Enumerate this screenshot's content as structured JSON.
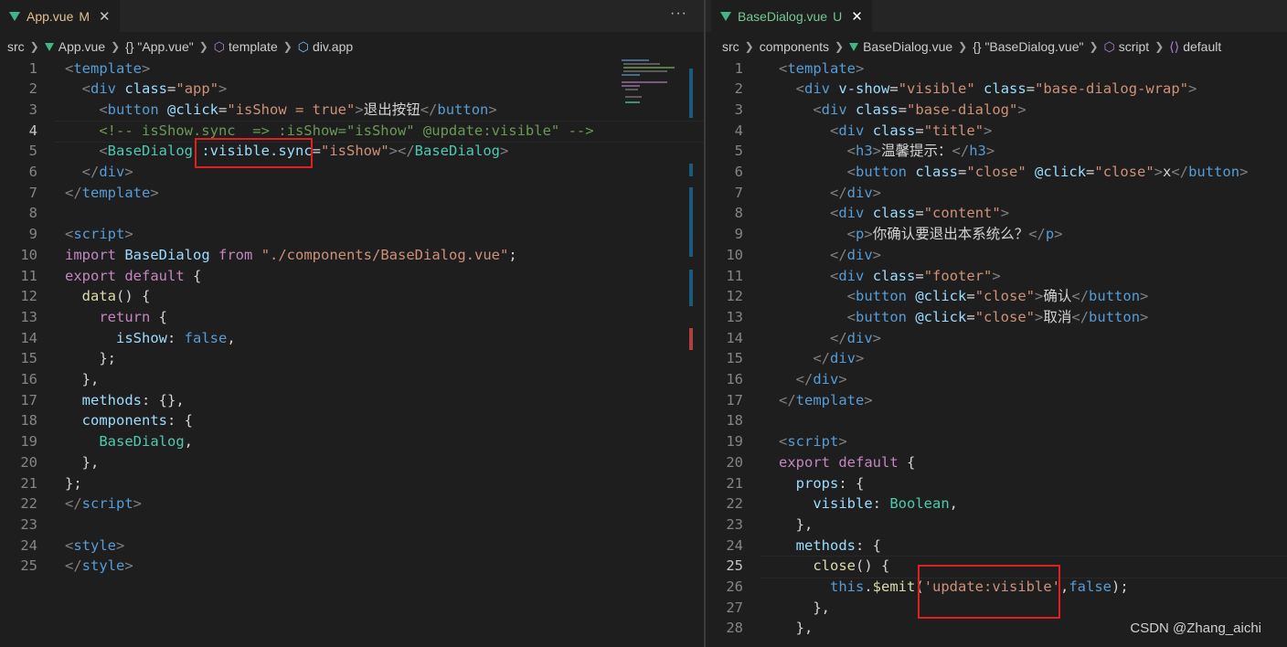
{
  "left": {
    "tab": {
      "name": "App.vue",
      "flag": "M",
      "close": "✕"
    },
    "more": "···",
    "breadcrumb": [
      "src",
      "App.vue",
      "{} \"App.vue\"",
      "template",
      "div.app"
    ],
    "lines": [
      [
        [
          "t-tag",
          "<"
        ],
        [
          "t-el",
          "template"
        ],
        [
          "t-tag",
          ">"
        ]
      ],
      [
        [
          "t-txt",
          "  "
        ],
        [
          "t-tag",
          "<"
        ],
        [
          "t-el",
          "div"
        ],
        [
          "t-txt",
          " "
        ],
        [
          "t-attr",
          "class"
        ],
        [
          "t-txt",
          "="
        ],
        [
          "t-str",
          "\"app\""
        ],
        [
          "t-tag",
          ">"
        ]
      ],
      [
        [
          "t-txt",
          "    "
        ],
        [
          "t-tag",
          "<"
        ],
        [
          "t-el",
          "button"
        ],
        [
          "t-txt",
          " "
        ],
        [
          "t-attr",
          "@click"
        ],
        [
          "t-txt",
          "="
        ],
        [
          "t-str",
          "\"isShow = true\""
        ],
        [
          "t-tag",
          ">"
        ],
        [
          "t-txt",
          "退出按钮"
        ],
        [
          "t-tag",
          "</"
        ],
        [
          "t-el",
          "button"
        ],
        [
          "t-tag",
          ">"
        ]
      ],
      [
        [
          "t-txt",
          "    "
        ],
        [
          "t-com",
          "<!-- isShow.sync  => :isShow=\"isShow\" @update:visible\" -->"
        ]
      ],
      [
        [
          "t-txt",
          "    "
        ],
        [
          "t-tag",
          "<"
        ],
        [
          "t-comp",
          "BaseDialog"
        ],
        [
          "t-txt",
          " "
        ],
        [
          "t-attr",
          ":visible.sync"
        ],
        [
          "t-txt",
          "="
        ],
        [
          "t-str",
          "\"isShow\""
        ],
        [
          "t-tag",
          "></"
        ],
        [
          "t-comp",
          "BaseDialog"
        ],
        [
          "t-tag",
          ">"
        ]
      ],
      [
        [
          "t-txt",
          "  "
        ],
        [
          "t-tag",
          "</"
        ],
        [
          "t-el",
          "div"
        ],
        [
          "t-tag",
          ">"
        ]
      ],
      [
        [
          "t-tag",
          "</"
        ],
        [
          "t-el",
          "template"
        ],
        [
          "t-tag",
          ">"
        ]
      ],
      [],
      [
        [
          "t-tag",
          "<"
        ],
        [
          "t-el",
          "script"
        ],
        [
          "t-tag",
          ">"
        ]
      ],
      [
        [
          "t-kw",
          "import"
        ],
        [
          "t-txt",
          " "
        ],
        [
          "t-pr",
          "BaseDialog"
        ],
        [
          "t-txt",
          " "
        ],
        [
          "t-kw",
          "from"
        ],
        [
          "t-txt",
          " "
        ],
        [
          "t-str",
          "\"./components/BaseDialog.vue\""
        ],
        [
          "t-txt",
          ";"
        ]
      ],
      [
        [
          "t-kw",
          "export"
        ],
        [
          "t-txt",
          " "
        ],
        [
          "t-kw",
          "default"
        ],
        [
          "t-txt",
          " {"
        ]
      ],
      [
        [
          "t-txt",
          "  "
        ],
        [
          "t-fn",
          "data"
        ],
        [
          "t-txt",
          "() {"
        ]
      ],
      [
        [
          "t-txt",
          "    "
        ],
        [
          "t-kw",
          "return"
        ],
        [
          "t-txt",
          " {"
        ]
      ],
      [
        [
          "t-txt",
          "      "
        ],
        [
          "t-pr",
          "isShow"
        ],
        [
          "t-txt",
          ": "
        ],
        [
          "t-kwb",
          "false"
        ],
        [
          "t-txt",
          ","
        ]
      ],
      [
        [
          "t-txt",
          "    };"
        ]
      ],
      [
        [
          "t-txt",
          "  },"
        ]
      ],
      [
        [
          "t-txt",
          "  "
        ],
        [
          "t-pr",
          "methods"
        ],
        [
          "t-txt",
          ": {},"
        ]
      ],
      [
        [
          "t-txt",
          "  "
        ],
        [
          "t-pr",
          "components"
        ],
        [
          "t-txt",
          ": {"
        ]
      ],
      [
        [
          "t-txt",
          "    "
        ],
        [
          "t-comp",
          "BaseDialog"
        ],
        [
          "t-txt",
          ","
        ]
      ],
      [
        [
          "t-txt",
          "  },"
        ]
      ],
      [
        [
          "t-txt",
          "};"
        ]
      ],
      [
        [
          "t-tag",
          "</"
        ],
        [
          "t-el",
          "script"
        ],
        [
          "t-tag",
          ">"
        ]
      ],
      [],
      [
        [
          "t-tag",
          "<"
        ],
        [
          "t-el",
          "style"
        ],
        [
          "t-tag",
          ">"
        ]
      ],
      [
        [
          "t-tag",
          "</"
        ],
        [
          "t-el",
          "style"
        ],
        [
          "t-tag",
          ">"
        ]
      ]
    ]
  },
  "right": {
    "tab": {
      "name": "BaseDialog.vue",
      "flag": "U",
      "close": "✕"
    },
    "breadcrumb": [
      "src",
      "components",
      "BaseDialog.vue",
      "{} \"BaseDialog.vue\"",
      "script",
      "default"
    ],
    "lines": [
      [
        [
          "t-tag",
          "<"
        ],
        [
          "t-el",
          "template"
        ],
        [
          "t-tag",
          ">"
        ]
      ],
      [
        [
          "t-txt",
          "  "
        ],
        [
          "t-tag",
          "<"
        ],
        [
          "t-el",
          "div"
        ],
        [
          "t-txt",
          " "
        ],
        [
          "t-attr",
          "v-show"
        ],
        [
          "t-txt",
          "="
        ],
        [
          "t-str",
          "\"visible\""
        ],
        [
          "t-txt",
          " "
        ],
        [
          "t-attr",
          "class"
        ],
        [
          "t-txt",
          "="
        ],
        [
          "t-str",
          "\"base-dialog-wrap\""
        ],
        [
          "t-tag",
          ">"
        ]
      ],
      [
        [
          "t-txt",
          "    "
        ],
        [
          "t-tag",
          "<"
        ],
        [
          "t-el",
          "div"
        ],
        [
          "t-txt",
          " "
        ],
        [
          "t-attr",
          "class"
        ],
        [
          "t-txt",
          "="
        ],
        [
          "t-str",
          "\"base-dialog\""
        ],
        [
          "t-tag",
          ">"
        ]
      ],
      [
        [
          "t-txt",
          "      "
        ],
        [
          "t-tag",
          "<"
        ],
        [
          "t-el",
          "div"
        ],
        [
          "t-txt",
          " "
        ],
        [
          "t-attr",
          "class"
        ],
        [
          "t-txt",
          "="
        ],
        [
          "t-str",
          "\"title\""
        ],
        [
          "t-tag",
          ">"
        ]
      ],
      [
        [
          "t-txt",
          "        "
        ],
        [
          "t-tag",
          "<"
        ],
        [
          "t-el",
          "h3"
        ],
        [
          "t-tag",
          ">"
        ],
        [
          "t-txt",
          "温馨提示："
        ],
        [
          "t-tag",
          "</"
        ],
        [
          "t-el",
          "h3"
        ],
        [
          "t-tag",
          ">"
        ]
      ],
      [
        [
          "t-txt",
          "        "
        ],
        [
          "t-tag",
          "<"
        ],
        [
          "t-el",
          "button"
        ],
        [
          "t-txt",
          " "
        ],
        [
          "t-attr",
          "class"
        ],
        [
          "t-txt",
          "="
        ],
        [
          "t-str",
          "\"close\""
        ],
        [
          "t-txt",
          " "
        ],
        [
          "t-attr",
          "@click"
        ],
        [
          "t-txt",
          "="
        ],
        [
          "t-str",
          "\"close\""
        ],
        [
          "t-tag",
          ">"
        ],
        [
          "t-txt",
          "x"
        ],
        [
          "t-tag",
          "</"
        ],
        [
          "t-el",
          "button"
        ],
        [
          "t-tag",
          ">"
        ]
      ],
      [
        [
          "t-txt",
          "      "
        ],
        [
          "t-tag",
          "</"
        ],
        [
          "t-el",
          "div"
        ],
        [
          "t-tag",
          ">"
        ]
      ],
      [
        [
          "t-txt",
          "      "
        ],
        [
          "t-tag",
          "<"
        ],
        [
          "t-el",
          "div"
        ],
        [
          "t-txt",
          " "
        ],
        [
          "t-attr",
          "class"
        ],
        [
          "t-txt",
          "="
        ],
        [
          "t-str",
          "\"content\""
        ],
        [
          "t-tag",
          ">"
        ]
      ],
      [
        [
          "t-txt",
          "        "
        ],
        [
          "t-tag",
          "<"
        ],
        [
          "t-el",
          "p"
        ],
        [
          "t-tag",
          ">"
        ],
        [
          "t-txt",
          "你确认要退出本系统么？"
        ],
        [
          "t-tag",
          "</"
        ],
        [
          "t-el",
          "p"
        ],
        [
          "t-tag",
          ">"
        ]
      ],
      [
        [
          "t-txt",
          "      "
        ],
        [
          "t-tag",
          "</"
        ],
        [
          "t-el",
          "div"
        ],
        [
          "t-tag",
          ">"
        ]
      ],
      [
        [
          "t-txt",
          "      "
        ],
        [
          "t-tag",
          "<"
        ],
        [
          "t-el",
          "div"
        ],
        [
          "t-txt",
          " "
        ],
        [
          "t-attr",
          "class"
        ],
        [
          "t-txt",
          "="
        ],
        [
          "t-str",
          "\"footer\""
        ],
        [
          "t-tag",
          ">"
        ]
      ],
      [
        [
          "t-txt",
          "        "
        ],
        [
          "t-tag",
          "<"
        ],
        [
          "t-el",
          "button"
        ],
        [
          "t-txt",
          " "
        ],
        [
          "t-attr",
          "@click"
        ],
        [
          "t-txt",
          "="
        ],
        [
          "t-str",
          "\"close\""
        ],
        [
          "t-tag",
          ">"
        ],
        [
          "t-txt",
          "确认"
        ],
        [
          "t-tag",
          "</"
        ],
        [
          "t-el",
          "button"
        ],
        [
          "t-tag",
          ">"
        ]
      ],
      [
        [
          "t-txt",
          "        "
        ],
        [
          "t-tag",
          "<"
        ],
        [
          "t-el",
          "button"
        ],
        [
          "t-txt",
          " "
        ],
        [
          "t-attr",
          "@click"
        ],
        [
          "t-txt",
          "="
        ],
        [
          "t-str",
          "\"close\""
        ],
        [
          "t-tag",
          ">"
        ],
        [
          "t-txt",
          "取消"
        ],
        [
          "t-tag",
          "</"
        ],
        [
          "t-el",
          "button"
        ],
        [
          "t-tag",
          ">"
        ]
      ],
      [
        [
          "t-txt",
          "      "
        ],
        [
          "t-tag",
          "</"
        ],
        [
          "t-el",
          "div"
        ],
        [
          "t-tag",
          ">"
        ]
      ],
      [
        [
          "t-txt",
          "    "
        ],
        [
          "t-tag",
          "</"
        ],
        [
          "t-el",
          "div"
        ],
        [
          "t-tag",
          ">"
        ]
      ],
      [
        [
          "t-txt",
          "  "
        ],
        [
          "t-tag",
          "</"
        ],
        [
          "t-el",
          "div"
        ],
        [
          "t-tag",
          ">"
        ]
      ],
      [
        [
          "t-tag",
          "</"
        ],
        [
          "t-el",
          "template"
        ],
        [
          "t-tag",
          ">"
        ]
      ],
      [],
      [
        [
          "t-tag",
          "<"
        ],
        [
          "t-el",
          "script"
        ],
        [
          "t-tag",
          ">"
        ]
      ],
      [
        [
          "t-kw",
          "export"
        ],
        [
          "t-txt",
          " "
        ],
        [
          "t-kw",
          "default"
        ],
        [
          "t-txt",
          " {"
        ]
      ],
      [
        [
          "t-txt",
          "  "
        ],
        [
          "t-pr",
          "props"
        ],
        [
          "t-txt",
          ": {"
        ]
      ],
      [
        [
          "t-txt",
          "    "
        ],
        [
          "t-pr",
          "visible"
        ],
        [
          "t-txt",
          ": "
        ],
        [
          "t-comp",
          "Boolean"
        ],
        [
          "t-txt",
          ","
        ]
      ],
      [
        [
          "t-txt",
          "  },"
        ]
      ],
      [
        [
          "t-txt",
          "  "
        ],
        [
          "t-pr",
          "methods"
        ],
        [
          "t-txt",
          ": {"
        ]
      ],
      [
        [
          "t-txt",
          "    "
        ],
        [
          "t-fn",
          "close"
        ],
        [
          "t-txt",
          "() {"
        ]
      ],
      [
        [
          "t-txt",
          "      "
        ],
        [
          "t-kwb",
          "this"
        ],
        [
          "t-txt",
          "."
        ],
        [
          "t-fn",
          "$emit"
        ],
        [
          "t-txt",
          "("
        ],
        [
          "t-str",
          "'update:visible'"
        ],
        [
          "t-txt",
          ","
        ],
        [
          "t-kwb",
          "false"
        ],
        [
          "t-txt",
          ");"
        ]
      ],
      [
        [
          "t-txt",
          "    },"
        ]
      ],
      [
        [
          "t-txt",
          "  },"
        ]
      ]
    ]
  },
  "watermark": "CSDN @Zhang_aichi",
  "colors": {
    "accent_red_box": "#e02020",
    "vue_green": "#41b883",
    "modified": "#e2c08d",
    "untracked": "#73c991"
  }
}
